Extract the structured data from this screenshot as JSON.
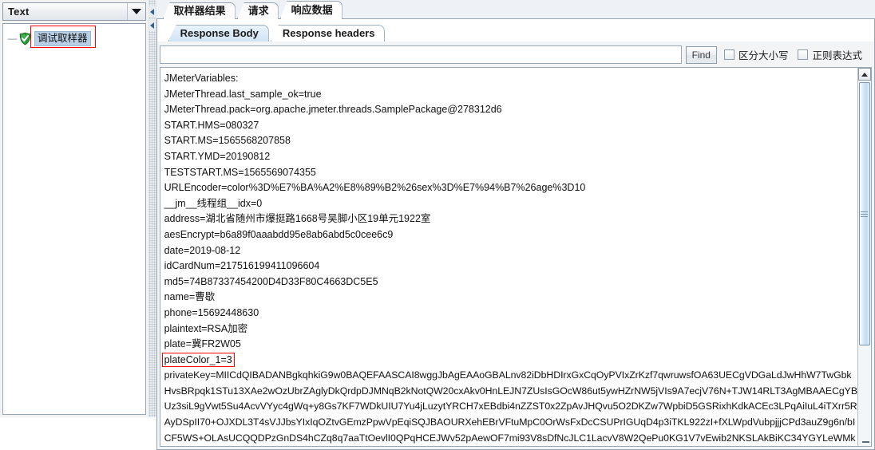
{
  "left_panel": {
    "render_combo": {
      "value": "Text",
      "arrow_icon": "chevron-down-icon"
    },
    "tree": {
      "handle": "—",
      "node_icon": "green-shield-check-icon",
      "node_label": "调试取样器"
    }
  },
  "splitter": {
    "collapse_left_icon": "triangle-left-icon",
    "collapse_right_icon": "triangle-left-icon"
  },
  "tabs": [
    {
      "label": "取样器结果",
      "selected": false
    },
    {
      "label": "请求",
      "selected": false
    },
    {
      "label": "响应数据",
      "selected": true
    }
  ],
  "sub_tabs": [
    {
      "label": "Response Body",
      "selected": true
    },
    {
      "label": "Response headers",
      "selected": false
    }
  ],
  "find_bar": {
    "input_value": "",
    "input_placeholder": "",
    "find_button": "Find",
    "case_sensitive_label": "区分大小写",
    "case_sensitive_checked": false,
    "regex_label": "正则表达式",
    "regex_checked": false
  },
  "response_body": {
    "lines": [
      "JMeterVariables:",
      "JMeterThread.last_sample_ok=true",
      "JMeterThread.pack=org.apache.jmeter.threads.SamplePackage@278312d6",
      "START.HMS=080327",
      "START.MS=1565568207858",
      "START.YMD=20190812",
      "TESTSTART.MS=1565569074355",
      "URLEncoder=color%3D%E7%BA%A2%E8%89%B2%26sex%3D%E7%94%B7%26age%3D10",
      "__jm__线程组__idx=0",
      "address=湖北省随州市爆挺路1668号吴脚小区19单元1922室",
      "aesEncrypt=b6a89f0aaabdd95e8ab6abd5c0cee6c9",
      "date=2019-08-12",
      "idCardNum=217516199411096604",
      "md5=74B87337454200D4D33F80C4663DC5E5",
      "name=曹歇",
      "phone=15692448630",
      "plaintext=RSA加密",
      "plate=冀FR2W05"
    ],
    "highlighted_line": "plateColor_1=3",
    "wrapped_lines": [
      "privateKey=MIICdQIBADANBgkqhkiG9w0BAQEFAASCAI8wggJbAgEAAoGBALnv82iDbHDIrxGxCqOyPVIxZrKzf7qwruwsfOA63UECgVDGaLdJwHhW7TwGbk",
      "HvsBRpqk1STu13XAe2wOzUbrZAglyDkQrdpDJMNqB2kNotQW20cxAkv0HnLEJN7ZUsIsGOcW86ut5ywHZrNW5jVIs9A7ecjV76N+TJW14RLT3AgMBAAECgYB",
      "Uz3siL9gVwt5Su4AcvVYyc4gWq+y8Gs7KF7WDkUIU7Yu4jLuzytYRCH7xEBdbi4nZZST0x2ZpAvJHQvu5O2DKZw7WpbiD5GSRixhKdkACEc3LPqAiIuL4iTXrr5R",
      "AyDSpII70+OJXDL3T4sVJJbsYIxIqOZtvGEmzPpwVpEqiSQJBAOURXehEBrVFtuMpC0OrWsFxDcCSUPrIGUqD4p3iTKL922zI+fXLWpdVubpjjjCPd3auZ9g6n/bI",
      "CF5WS+OLAsUCQQDPzGnDS4hCZq8q7aaTtOevlI0QPqHCEJWv52pAewOF7mi93V8sDfNcJLC1LacvV8W2QePu0KG1V7vEwib2NKSLAkBiKC34YGYLeWMk"
    ]
  },
  "scrollbar": {
    "up_arrow_icon": "triangle-up-icon",
    "thumb_grip_icon": "grip-lines-icon"
  }
}
